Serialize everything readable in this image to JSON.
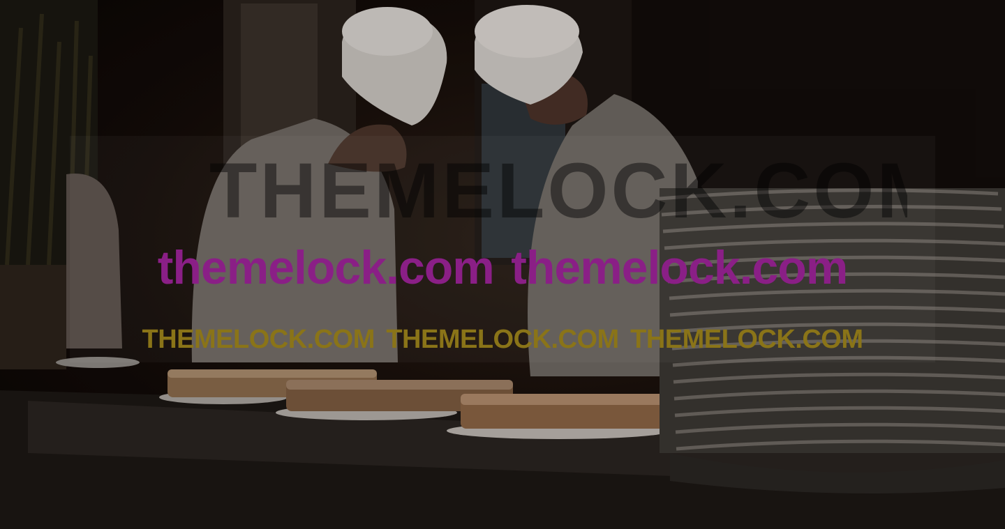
{
  "scene": {
    "description_icon": "kitchen-photo"
  },
  "watermarks": {
    "big_text": "THEMELOCK.COM",
    "row1": [
      "themelock.com",
      "themelock.com"
    ],
    "row2": [
      "THEMELOCK.COM",
      "THEMELOCK.COM",
      "THEMELOCK.COM"
    ]
  },
  "colors": {
    "row1": "#8a1f86",
    "row2": "#8a7418"
  }
}
